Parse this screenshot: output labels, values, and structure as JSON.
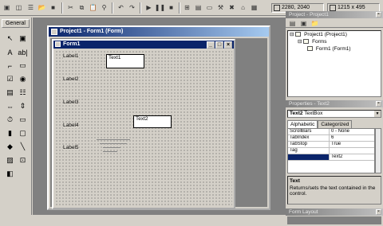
{
  "toolbar": {
    "coords": "2280, 2040",
    "size": "1215 x 495"
  },
  "toolbox": {
    "title": "General"
  },
  "project_window": {
    "title": "Project1 - Form1 (Form)"
  },
  "form": {
    "title": "Form1",
    "labels": [
      "Label1",
      "Label2",
      "Label3",
      "Label4",
      "Label5"
    ],
    "textboxes": [
      "Text1",
      "Text2"
    ]
  },
  "project_explorer": {
    "title": "Project - Project1",
    "root": "Project1 (Project1)",
    "folder": "Forms",
    "file": "Form1 (Form1)"
  },
  "properties": {
    "title": "Properties - Text2",
    "object_name": "Text2",
    "object_type": "TextBox",
    "tabs": [
      "Alphabetic",
      "Categorized"
    ],
    "rows": [
      {
        "name": "ScrollBars",
        "value": "0 - None"
      },
      {
        "name": "TabIndex",
        "value": "6"
      },
      {
        "name": "TabStop",
        "value": "True"
      },
      {
        "name": "Tag",
        "value": ""
      },
      {
        "name": "",
        "value": "Text2"
      }
    ],
    "desc_title": "Text",
    "desc_text": "Returns/sets the text contained in the control."
  },
  "form_layout": {
    "title": "Form Layout"
  }
}
